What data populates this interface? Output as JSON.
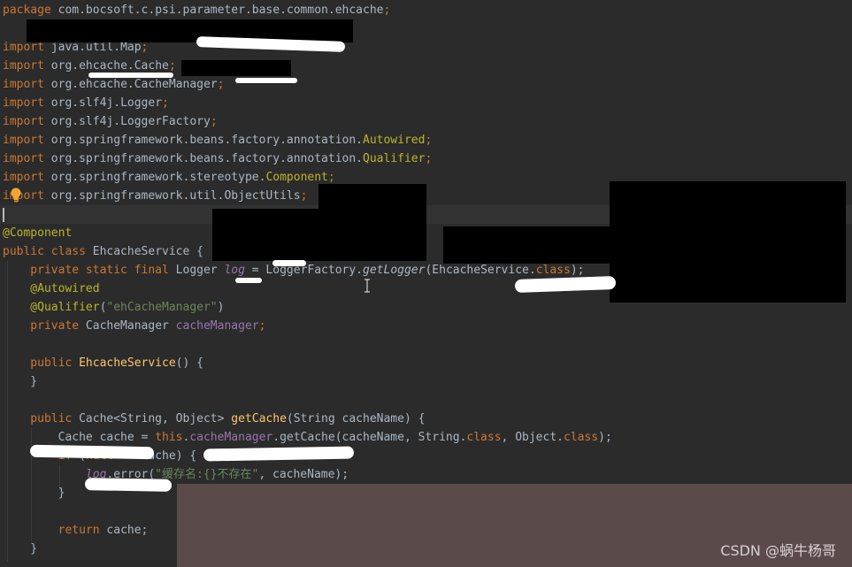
{
  "editor": {
    "lines": [
      {
        "parts": [
          {
            "t": "package ",
            "c": "kw"
          },
          {
            "t": "com.bocsoft.c.psi.parameter.base.common.ehcache",
            "c": ""
          },
          {
            "t": ";",
            "c": "kw"
          }
        ]
      },
      {
        "parts": []
      },
      {
        "parts": [
          {
            "t": "import ",
            "c": "kw"
          },
          {
            "t": "java.util.Map",
            "c": ""
          },
          {
            "t": ";",
            "c": "kw"
          }
        ]
      },
      {
        "parts": [
          {
            "t": "import ",
            "c": "kw"
          },
          {
            "t": "org.ehcache.Cache",
            "c": ""
          },
          {
            "t": ";",
            "c": "kw"
          }
        ]
      },
      {
        "parts": [
          {
            "t": "import ",
            "c": "kw"
          },
          {
            "t": "org.ehcache.CacheManager",
            "c": ""
          },
          {
            "t": ";",
            "c": "kw"
          }
        ]
      },
      {
        "parts": [
          {
            "t": "import ",
            "c": "kw"
          },
          {
            "t": "org.slf4j.Logger",
            "c": ""
          },
          {
            "t": ";",
            "c": "kw"
          }
        ]
      },
      {
        "parts": [
          {
            "t": "import ",
            "c": "kw"
          },
          {
            "t": "org.slf4j.LoggerFactory",
            "c": ""
          },
          {
            "t": ";",
            "c": "kw"
          }
        ]
      },
      {
        "parts": [
          {
            "t": "import ",
            "c": "kw"
          },
          {
            "t": "org.springframework.beans.factory.annotation.",
            "c": ""
          },
          {
            "t": "Autowired",
            "c": "ann"
          },
          {
            "t": ";",
            "c": "kw"
          }
        ]
      },
      {
        "parts": [
          {
            "t": "import ",
            "c": "kw"
          },
          {
            "t": "org.springframework.beans.factory.annotation.",
            "c": ""
          },
          {
            "t": "Qualifier",
            "c": "ann"
          },
          {
            "t": ";",
            "c": "kw"
          }
        ]
      },
      {
        "parts": [
          {
            "t": "import ",
            "c": "kw"
          },
          {
            "t": "org.springframework.stereotype.",
            "c": ""
          },
          {
            "t": "Component",
            "c": "ann"
          },
          {
            "t": ";",
            "c": "kw"
          }
        ]
      },
      {
        "parts": [
          {
            "t": "import ",
            "c": "kw"
          },
          {
            "t": "org.springframework.util.ObjectUtils",
            "c": ""
          },
          {
            "t": ";",
            "c": "kw"
          }
        ]
      },
      {
        "parts": []
      },
      {
        "parts": [
          {
            "t": "@Component",
            "c": "ann"
          }
        ]
      },
      {
        "parts": [
          {
            "t": "public class ",
            "c": "kw"
          },
          {
            "t": "EhcacheService {",
            "c": ""
          }
        ]
      },
      {
        "parts": [
          {
            "t": "    private static final ",
            "c": "kw"
          },
          {
            "t": "Logger ",
            "c": ""
          },
          {
            "t": "log",
            "c": "fld static-call"
          },
          {
            "t": " = LoggerFactory.",
            "c": ""
          },
          {
            "t": "getLogger",
            "c": "static-call"
          },
          {
            "t": "(EhcacheService.",
            "c": ""
          },
          {
            "t": "class",
            "c": "kw"
          },
          {
            "t": ");",
            "c": ""
          }
        ]
      },
      {
        "parts": [
          {
            "t": "    @Autowired",
            "c": "ann"
          }
        ]
      },
      {
        "parts": [
          {
            "t": "    @Qualifier",
            "c": "ann"
          },
          {
            "t": "(",
            "c": ""
          },
          {
            "t": "\"ehCacheManager\"",
            "c": "str"
          },
          {
            "t": ")",
            "c": ""
          }
        ]
      },
      {
        "parts": [
          {
            "t": "    private ",
            "c": "kw"
          },
          {
            "t": "CacheManager ",
            "c": ""
          },
          {
            "t": "cacheManager",
            "c": "fld"
          },
          {
            "t": ";",
            "c": "kw"
          }
        ]
      },
      {
        "parts": []
      },
      {
        "parts": [
          {
            "t": "    public ",
            "c": "kw"
          },
          {
            "t": "EhcacheService",
            "c": "mtd"
          },
          {
            "t": "() {",
            "c": ""
          }
        ]
      },
      {
        "parts": [
          {
            "t": "    }",
            "c": ""
          }
        ]
      },
      {
        "parts": []
      },
      {
        "parts": [
          {
            "t": "    public ",
            "c": "kw"
          },
          {
            "t": "Cache<String, Object> ",
            "c": ""
          },
          {
            "t": "getCache",
            "c": "mtd"
          },
          {
            "t": "(String cacheName) {",
            "c": ""
          }
        ]
      },
      {
        "parts": [
          {
            "t": "        Cache cache = ",
            "c": ""
          },
          {
            "t": "this",
            "c": "kw"
          },
          {
            "t": ".",
            "c": ""
          },
          {
            "t": "cacheManager",
            "c": "fld"
          },
          {
            "t": ".getCache(cacheName, String.",
            "c": ""
          },
          {
            "t": "class",
            "c": "kw"
          },
          {
            "t": ", ",
            "c": ""
          },
          {
            "t": "Object.",
            "c": ""
          },
          {
            "t": "class",
            "c": "kw"
          },
          {
            "t": ");",
            "c": ""
          }
        ]
      },
      {
        "parts": [
          {
            "t": "        ",
            "c": ""
          },
          {
            "t": "if ",
            "c": "kw"
          },
          {
            "t": "(",
            "c": ""
          },
          {
            "t": "null",
            "c": "kw"
          },
          {
            "t": " == cache) {",
            "c": ""
          }
        ]
      },
      {
        "parts": [
          {
            "t": "            ",
            "c": ""
          },
          {
            "t": "log",
            "c": "fld static-call"
          },
          {
            "t": ".error(",
            "c": ""
          },
          {
            "t": "\"缓存名:{}不存在\"",
            "c": "str"
          },
          {
            "t": ", cacheName);",
            "c": ""
          }
        ]
      },
      {
        "parts": [
          {
            "t": "        }",
            "c": ""
          }
        ]
      },
      {
        "parts": []
      },
      {
        "parts": [
          {
            "t": "        ",
            "c": ""
          },
          {
            "t": "return ",
            "c": "kw"
          },
          {
            "t": "cache;",
            "c": ""
          }
        ]
      },
      {
        "parts": [
          {
            "t": "    }",
            "c": ""
          }
        ]
      }
    ],
    "current_line": 11
  },
  "watermark": "CSDN @蜗牛杨哥",
  "colors": {
    "background": "#2b2b2b",
    "keyword": "#cc7832",
    "annotation": "#bbb529",
    "string": "#6a8759",
    "field": "#9876aa",
    "method": "#ffc66d",
    "text": "#a9b7c6"
  },
  "icons": {
    "intention": "lightbulb-icon",
    "cursor": "text-cursor-icon"
  }
}
